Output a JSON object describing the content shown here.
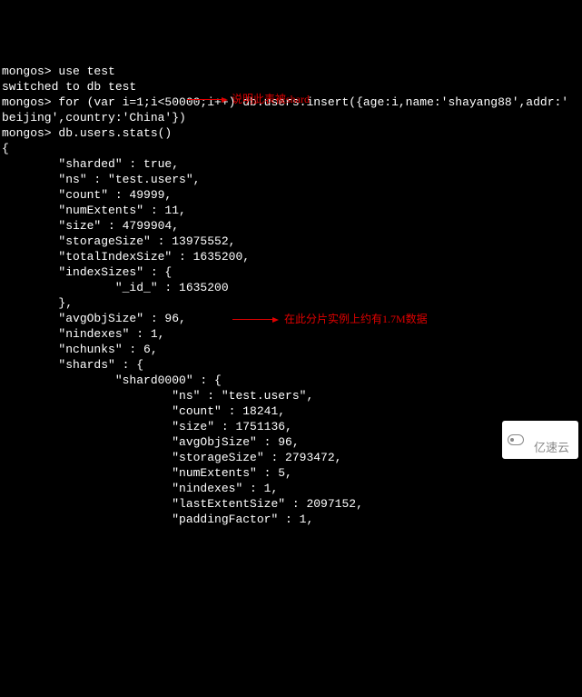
{
  "lines": [
    "mongos> use test",
    "switched to db test",
    "mongos> for (var i=1;i<50000;i++) db.users.insert({age:i,name:'shayang88',addr:'",
    "beijing',country:'China'})",
    "mongos> db.users.stats()",
    "{",
    "        \"sharded\" : true,",
    "        \"ns\" : \"test.users\",",
    "        \"count\" : 49999,",
    "        \"numExtents\" : 11,",
    "        \"size\" : 4799904,",
    "        \"storageSize\" : 13975552,",
    "        \"totalIndexSize\" : 1635200,",
    "        \"indexSizes\" : {",
    "                \"_id_\" : 1635200",
    "        },",
    "        \"avgObjSize\" : 96,",
    "        \"nindexes\" : 1,",
    "        \"nchunks\" : 6,",
    "        \"shards\" : {",
    "                \"shard0000\" : {",
    "                        \"ns\" : \"test.users\",",
    "                        \"count\" : 18241,",
    "                        \"size\" : 1751136,",
    "                        \"avgObjSize\" : 96,",
    "                        \"storageSize\" : 2793472,",
    "                        \"numExtents\" : 5,",
    "                        \"nindexes\" : 1,",
    "                        \"lastExtentSize\" : 2097152,",
    "                        \"paddingFactor\" : 1,"
  ],
  "annotations": {
    "sharded_note": "说明此表被shard",
    "shard0000_note": "在此分片实例上约有1.7M数据"
  },
  "watermark": "亿速云"
}
